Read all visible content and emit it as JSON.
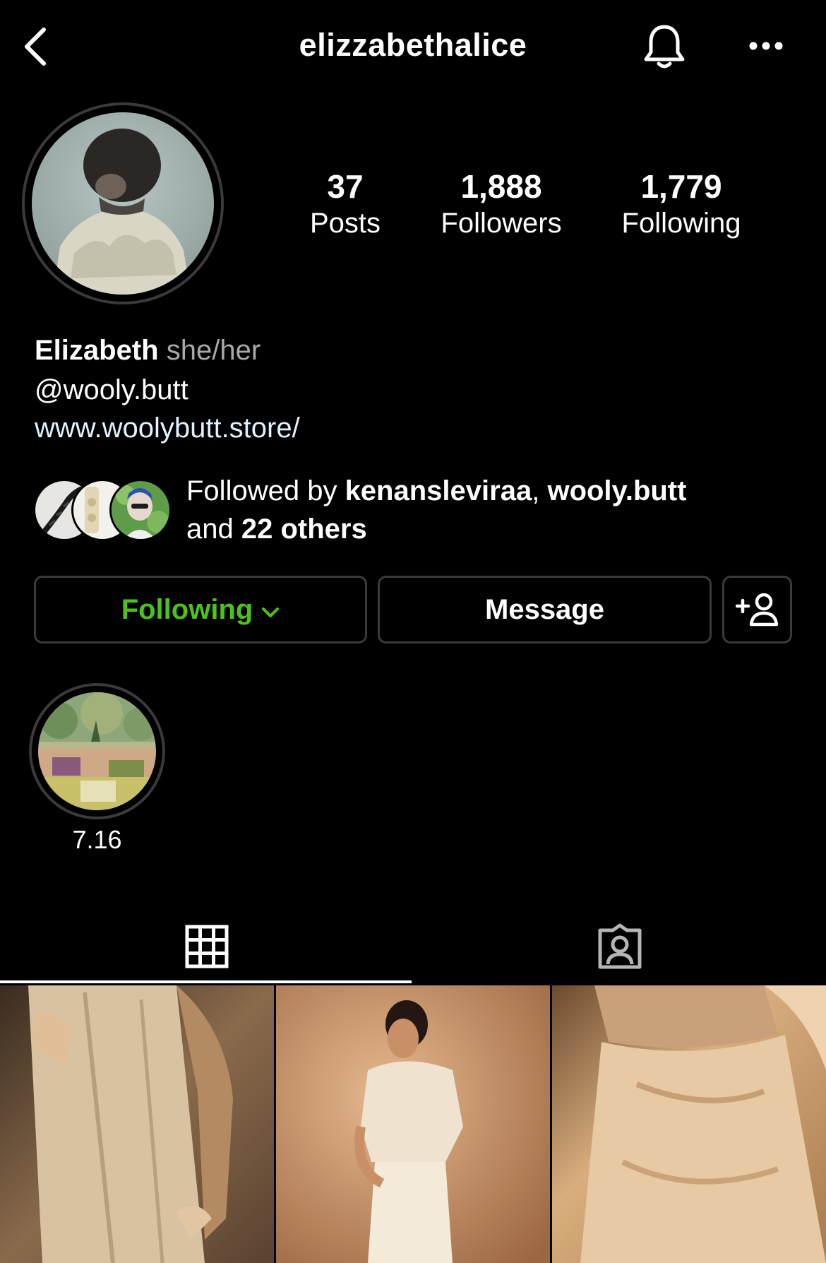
{
  "header": {
    "username": "elizzabethalice",
    "icons": {
      "back": "chevron-left-icon",
      "notifications": "bell-icon",
      "more": "more-horizontal-icon"
    }
  },
  "profile": {
    "stats": [
      {
        "count": "37",
        "label": "Posts"
      },
      {
        "count": "1,888",
        "label": "Followers"
      },
      {
        "count": "1,779",
        "label": "Following"
      }
    ],
    "name": "Elizabeth",
    "pronouns": "she/her",
    "mention": "@wooly.butt",
    "website": "www.woolybutt.store/"
  },
  "followed_by": {
    "prefix": "Followed by",
    "user1": "kenansleviraa",
    "separator": ",",
    "user2": "wooly.butt",
    "and_text": "and",
    "others": "22 others"
  },
  "actions": {
    "following_label": "Following",
    "message_label": "Message",
    "accent": "#4cc21a"
  },
  "highlights": [
    {
      "label": "7.16"
    }
  ],
  "tabs": {
    "grid_icon": "grid-icon",
    "tagged_icon": "tagged-person-icon"
  },
  "colors": {
    "background": "#000000",
    "border": "#3a3a3a",
    "following_green": "#4cc21a",
    "link": "#e0f1ff"
  }
}
